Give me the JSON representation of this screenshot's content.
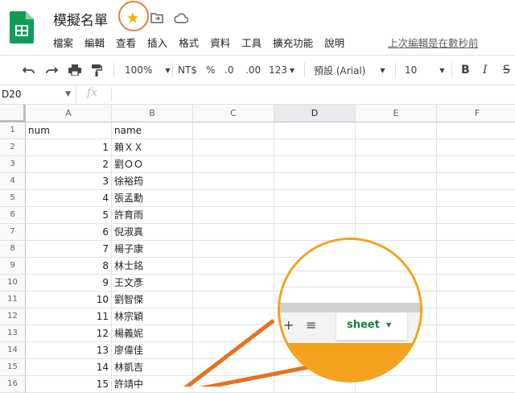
{
  "app": {
    "doc_title": "模擬名單",
    "last_edit": "上次編輯是在數秒前",
    "brand_color": "#0f9d58",
    "accent_color": "#f4a11e",
    "menu": [
      "檔案",
      "編輯",
      "查看",
      "插入",
      "格式",
      "資料",
      "工具",
      "擴充功能",
      "說明"
    ]
  },
  "toolbar": {
    "zoom": "100%",
    "currency": "NT$",
    "percent": "%",
    "dec_decrease": ".0",
    "dec_increase": ".00",
    "more_formats": "123",
    "font": "預設 (Arial)",
    "font_size": "10",
    "bold": "B",
    "italic": "I",
    "strike": "S"
  },
  "formula_bar": {
    "cell_ref": "D20",
    "fx": "fx",
    "value": ""
  },
  "columns": [
    "A",
    "B",
    "C",
    "D",
    "E",
    "F"
  ],
  "rows": [
    {
      "n": "1",
      "a": "num",
      "b": "name"
    },
    {
      "n": "2",
      "a": "1",
      "b": "賴ＸＸ"
    },
    {
      "n": "3",
      "a": "2",
      "b": "劉ＯＯ"
    },
    {
      "n": "4",
      "a": "3",
      "b": "徐裕筠"
    },
    {
      "n": "5",
      "a": "4",
      "b": "張孟勳"
    },
    {
      "n": "6",
      "a": "5",
      "b": "許育雨"
    },
    {
      "n": "7",
      "a": "6",
      "b": "倪淑真"
    },
    {
      "n": "8",
      "a": "7",
      "b": "楊子康"
    },
    {
      "n": "9",
      "a": "8",
      "b": "林士銘"
    },
    {
      "n": "10",
      "a": "9",
      "b": "王文彥"
    },
    {
      "n": "11",
      "a": "10",
      "b": "劉智傑"
    },
    {
      "n": "12",
      "a": "11",
      "b": "林宗穎"
    },
    {
      "n": "13",
      "a": "12",
      "b": "楊義妮"
    },
    {
      "n": "14",
      "a": "13",
      "b": "廖偉佳"
    },
    {
      "n": "15",
      "a": "14",
      "b": "林凱吉"
    },
    {
      "n": "16",
      "a": "15",
      "b": "許靖中"
    }
  ],
  "zoom_callout": {
    "sheet_tab_label": "sheet",
    "add_sheet": "+",
    "all_sheets": "≡"
  }
}
